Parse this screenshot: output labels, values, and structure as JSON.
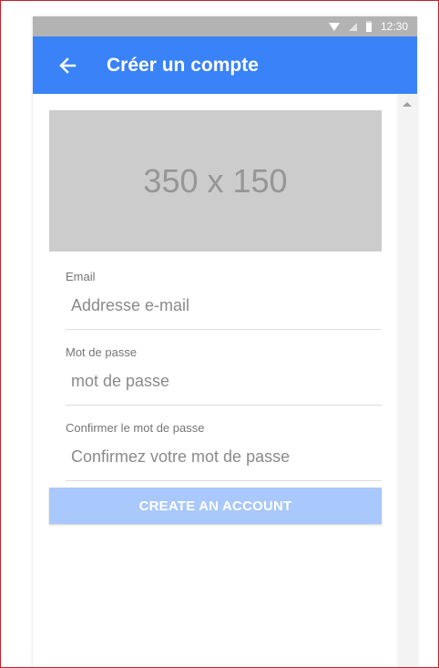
{
  "status_bar": {
    "time": "12:30",
    "icons": [
      "wifi-icon",
      "signal-icon",
      "battery-icon"
    ]
  },
  "app_bar": {
    "back_icon": "arrow-left-icon",
    "title": "Créer un compte",
    "color": "#3a82f7"
  },
  "image_placeholder": {
    "text": "350 x 150"
  },
  "form": {
    "email": {
      "label": "Email",
      "placeholder": "Addresse e-mail",
      "value": ""
    },
    "password": {
      "label": "Mot de passe",
      "placeholder": "mot de passe",
      "value": ""
    },
    "confirm": {
      "label": "Confirmer le mot de passe",
      "placeholder": "Confirmez votre mot de passe",
      "value": ""
    }
  },
  "submit": {
    "label": "CREATE AN ACCOUNT",
    "color": "#a9c8fb"
  }
}
